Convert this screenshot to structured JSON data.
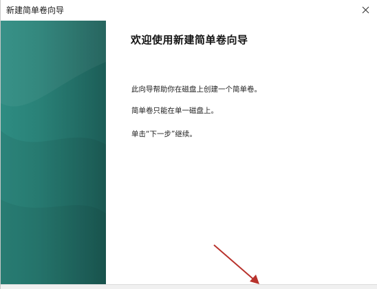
{
  "window": {
    "title": "新建简单卷向导"
  },
  "content": {
    "heading": "欢迎使用新建简单卷向导",
    "paragraphs": [
      "此向导帮助你在磁盘上创建一个简单卷。",
      "简单卷只能在单一磁盘上。",
      "单击“下一步”继续。"
    ]
  },
  "icons": {
    "close": "close-icon"
  },
  "colors": {
    "sidebar_start": "#2e8c82",
    "sidebar_end": "#1c5d57",
    "annotation_arrow": "#b8322c"
  }
}
